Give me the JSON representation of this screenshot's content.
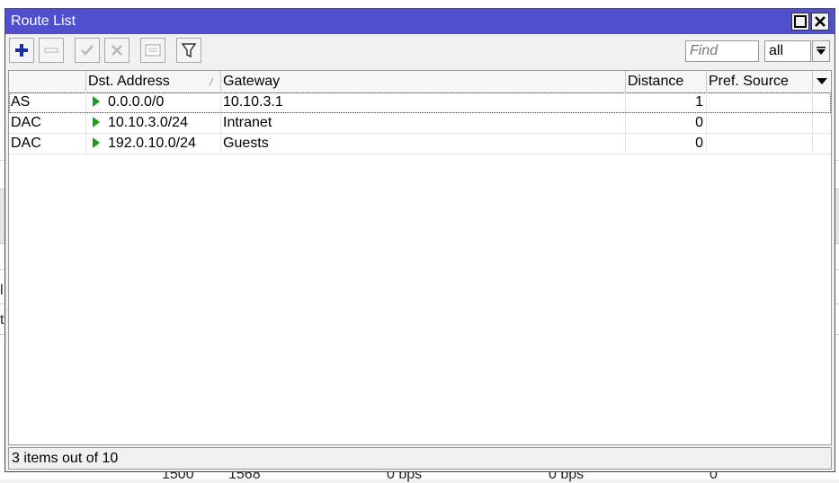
{
  "window": {
    "title": "Route List"
  },
  "titlebar_buttons": {
    "maximize_icon": "maximize-icon",
    "close_icon": "close-icon"
  },
  "toolbar": {
    "icons": [
      "plus-icon",
      "minus-icon",
      "check-icon",
      "x-icon",
      "comment-icon",
      "filter-icon"
    ],
    "find_placeholder": "Find",
    "filter_value": "all"
  },
  "table": {
    "columns": [
      "",
      "Dst. Address",
      "Gateway",
      "Distance",
      "Pref. Source"
    ],
    "rows": [
      {
        "flags": "AS",
        "dst": "0.0.0.0/0",
        "gateway": "10.10.3.1",
        "distance": "1",
        "pref_source": ""
      },
      {
        "flags": "DAC",
        "dst": "10.10.3.0/24",
        "gateway": "Intranet",
        "distance": "0",
        "pref_source": ""
      },
      {
        "flags": "DAC",
        "dst": "192.0.10.0/24",
        "gateway": "Guests",
        "distance": "0",
        "pref_source": ""
      }
    ]
  },
  "status": "3 items out of 10",
  "background": {
    "left_fragments": [
      "l",
      "t"
    ],
    "bottom_fragments": [
      "1500",
      "1568",
      "0 bps",
      "0 bps",
      "0"
    ]
  },
  "colors": {
    "titlebar": "#5050cf",
    "add_icon": "#1a2fa0",
    "arrow": "#1aa01a"
  }
}
